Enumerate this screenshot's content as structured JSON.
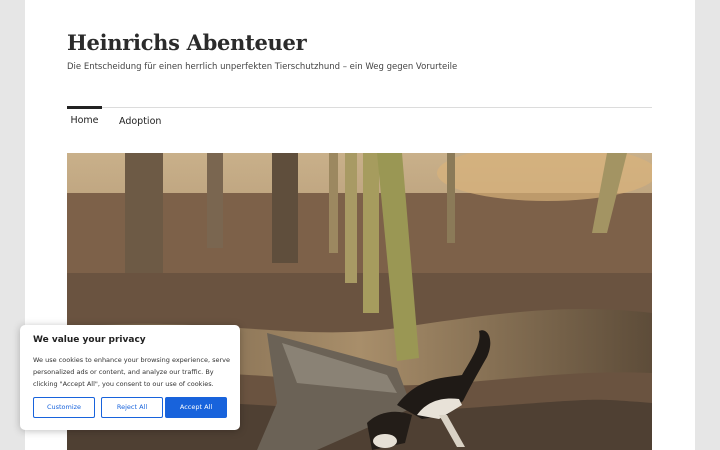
{
  "header": {
    "site_title": "Heinrichs Abenteuer",
    "tagline": "Die Entscheidung für einen herrlich unperfekten Tierschutzhund – ein Weg gegen Vorurteile"
  },
  "nav": {
    "items": [
      {
        "label": "Home",
        "active": true
      },
      {
        "label": "Adoption",
        "active": false
      }
    ]
  },
  "hero": {
    "icon": "forest-dog-photo"
  },
  "cookie_banner": {
    "title": "We value your privacy",
    "text": "We use cookies to enhance your browsing experience, serve personalized ads or content, and analyze our traffic. By clicking \"Accept All\", you consent to our use of cookies.",
    "buttons": {
      "customize": "Customize",
      "reject": "Reject All",
      "accept": "Accept All"
    },
    "accent_color": "#1863dc"
  }
}
